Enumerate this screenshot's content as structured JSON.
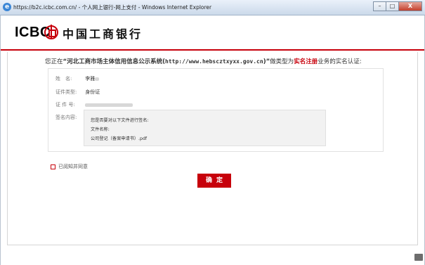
{
  "window": {
    "title": "https://b2c.icbc.com.cn/ - 个人网上银行-网上支付 - Windows Internet Explorer",
    "buttons": {
      "minimize": "–",
      "maximize": "□",
      "close": "X"
    }
  },
  "header": {
    "logo_text": "ICBC",
    "bank_name": "中国工商银行",
    "brand_color": "#c7000b"
  },
  "notice": {
    "prefix": "您正在",
    "system_name": "“河北工商市场主体信用信息公示系统(",
    "url": "http://www.hebscztxyxx.gov.cn",
    "suffix_quote": ")”",
    "middle": "做类型为",
    "type": "实名注册",
    "end": "业务的实名认证:"
  },
  "info": {
    "name_label": "姓　名:",
    "name_value": "李雅",
    "id_type_label": "证件类型:",
    "id_type_value": "身份证",
    "id_no_label": "证 件 号:",
    "sign_label": "签名内容:"
  },
  "sign": {
    "line1": "您是否要对以下文件进行签名:",
    "line2": "文件名称:",
    "line3": "公司登记（备案申请书）.pdf"
  },
  "agree": {
    "label": "已阅知并同意"
  },
  "confirm": {
    "label": "确定"
  }
}
